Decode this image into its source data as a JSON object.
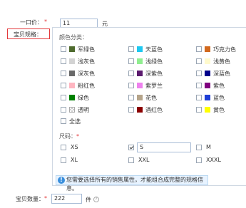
{
  "price": {
    "label": "一口价：",
    "required_mark": "*",
    "value": "11",
    "unit": "元"
  },
  "spec": {
    "label": "宝贝规格："
  },
  "colors": {
    "title": "颜色分类：",
    "items": [
      {
        "name": "军绿色",
        "color": "#4f6b2e"
      },
      {
        "name": "天蓝色",
        "color": "#1ec8f0"
      },
      {
        "name": "巧克力色",
        "color": "#d2691e"
      },
      {
        "name": "浅灰色",
        "color": "#d3d3d3"
      },
      {
        "name": "浅绿色",
        "color": "#90ee90"
      },
      {
        "name": "浅黄色",
        "color": "#fffacd"
      },
      {
        "name": "深灰色",
        "color": "#696969"
      },
      {
        "name": "深紫色",
        "color": "#5b1a6e"
      },
      {
        "name": "深蓝色",
        "color": "#00008b"
      },
      {
        "name": "粉红色",
        "color": "#ffb6c1"
      },
      {
        "name": "紫罗兰",
        "color": "#ee82ee"
      },
      {
        "name": "紫色",
        "color": "#800080"
      },
      {
        "name": "绿色",
        "color": "#008000"
      },
      {
        "name": "花色",
        "color": "#b5a48a"
      },
      {
        "name": "蓝色",
        "color": "#1f3fd6"
      },
      {
        "name": "透明",
        "color": "transparent"
      },
      {
        "name": "酒红色",
        "color": "#8b0000"
      },
      {
        "name": "黄色",
        "color": "#ffff00"
      }
    ],
    "select_all": "全选"
  },
  "sizes": {
    "title": "尺码：",
    "required_mark": "*",
    "items": [
      {
        "name": "XS",
        "checked": false
      },
      {
        "name": "S",
        "checked": true
      },
      {
        "name": "M",
        "checked": false
      },
      {
        "name": "XL",
        "checked": false
      },
      {
        "name": "XXL",
        "checked": false
      },
      {
        "name": "XXXL",
        "checked": false
      }
    ]
  },
  "notice": {
    "text": "您需要选择所有的销售属性，才能组合成完整的规格信息。",
    "icon": "info-icon"
  },
  "quantity": {
    "label": "宝贝数量：",
    "required_mark": "*",
    "value": "222",
    "unit": "件"
  }
}
